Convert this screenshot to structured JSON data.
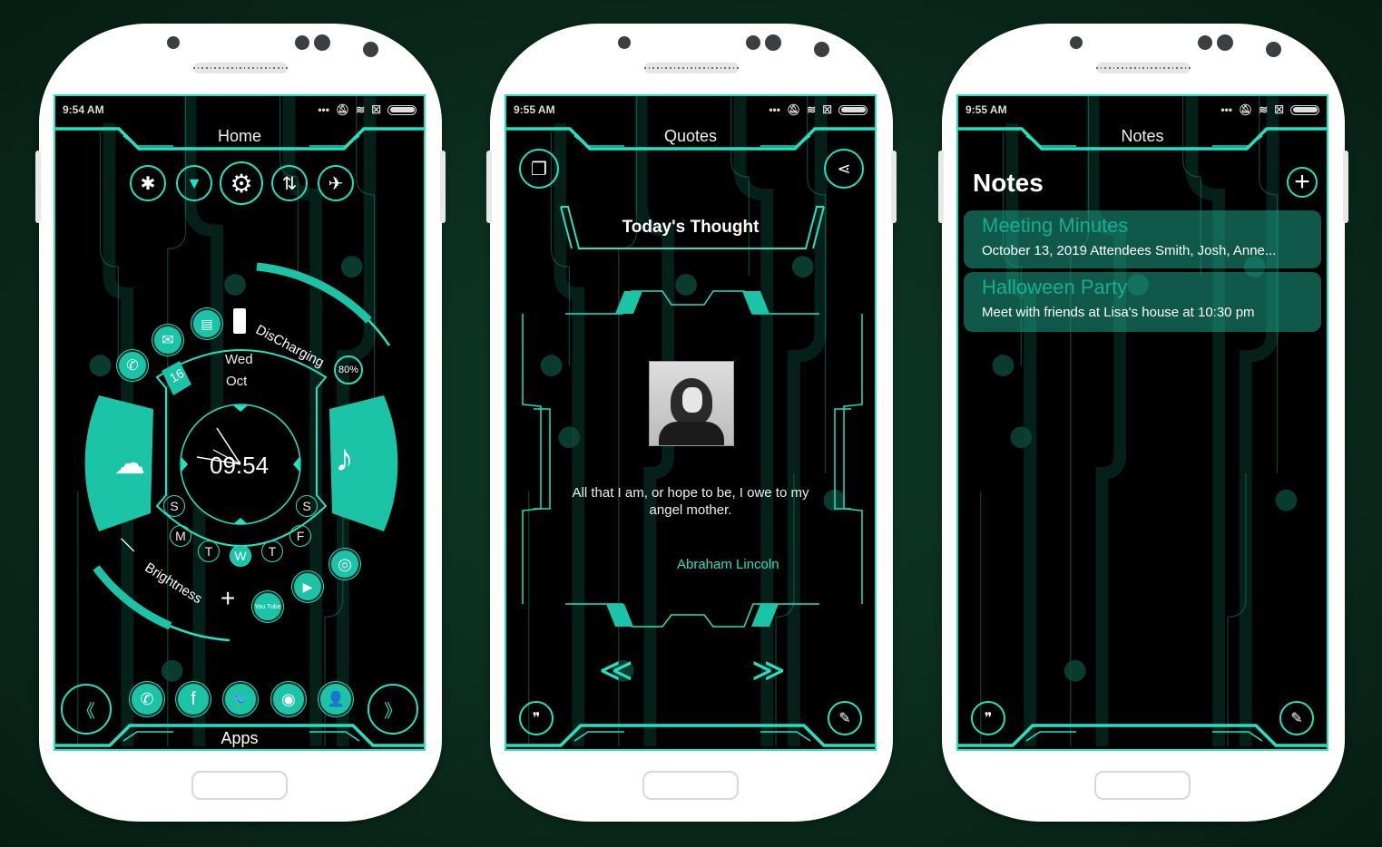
{
  "colors": {
    "accent": "#1fe3c2",
    "accent_fill": "#1bc4a6",
    "background": "#0a2a1c",
    "screen": "#000000"
  },
  "status_icons": [
    "more-dots-icon",
    "mute-icon",
    "wifi-icon",
    "sim-icon",
    "battery-icon"
  ],
  "phones": [
    {
      "screen": "home",
      "status_time": "9:54 AM",
      "title": "Home",
      "quick_toggles": [
        {
          "name": "bluetooth-icon",
          "glyph": "✱"
        },
        {
          "name": "wifi-icon",
          "glyph": "▼"
        },
        {
          "name": "settings-gear-icon",
          "glyph": "⚙"
        },
        {
          "name": "data-transfer-icon",
          "glyph": "⇅"
        },
        {
          "name": "airplane-icon",
          "glyph": "✈"
        }
      ],
      "battery": {
        "label": "DisCharging",
        "percent_label": "80%",
        "level": 0.8
      },
      "date": {
        "day_number": "16",
        "weekday": "Wed",
        "month": "Oct"
      },
      "clock": {
        "digital": "09:54"
      },
      "weekdays": [
        "S",
        "M",
        "T",
        "W",
        "T",
        "F",
        "S"
      ],
      "active_weekday_index": 3,
      "brightness": {
        "label": "Brightness",
        "minus": "—",
        "plus": "+",
        "level": 0.3
      },
      "left_apps": [
        {
          "name": "phone-icon",
          "glyph": "✆"
        },
        {
          "name": "email-icon",
          "glyph": "✉"
        },
        {
          "name": "message-icon",
          "glyph": "▤"
        }
      ],
      "right_apps": [
        {
          "name": "youtube-icon",
          "glyph": "You Tube"
        },
        {
          "name": "play-store-icon",
          "glyph": "▶"
        },
        {
          "name": "chrome-icon",
          "glyph": "◎"
        }
      ],
      "weather_icon": "weather-icon",
      "music_icon": "music-icon",
      "dock": [
        {
          "name": "whatsapp-icon",
          "glyph": "✆"
        },
        {
          "name": "facebook-icon",
          "glyph": "f"
        },
        {
          "name": "twitter-icon",
          "glyph": "🐦"
        },
        {
          "name": "instagram-icon",
          "glyph": "◉"
        },
        {
          "name": "contacts-icon",
          "glyph": "👤"
        }
      ],
      "prev_label": "《",
      "next_label": "》",
      "footer_label": "Apps"
    },
    {
      "screen": "quotes",
      "status_time": "9:55 AM",
      "title": "Quotes",
      "header": "Today's Thought",
      "quote_text": "All that I am, or hope to be, I owe to my angel mother.",
      "author": "Abraham Lincoln",
      "nav_prev": "≪",
      "nav_next": "≫"
    },
    {
      "screen": "notes",
      "status_time": "9:55 AM",
      "title": "Notes",
      "heading": "Notes",
      "add_label": "+",
      "notes": [
        {
          "title": "Meeting Minutes",
          "body": "October 13, 2019 Attendees Smith, Josh, Anne..."
        },
        {
          "title": "Halloween Party",
          "body": "Meet with friends at Lisa's house at 10:30 pm"
        }
      ]
    }
  ]
}
